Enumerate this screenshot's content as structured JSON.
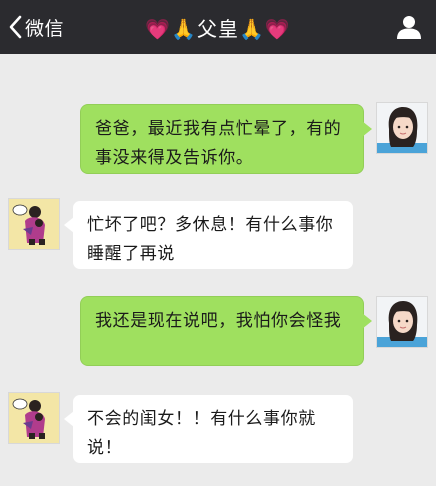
{
  "header": {
    "back_label": "微信",
    "title": "💗🙏父皇🙏💗"
  },
  "messages": [
    {
      "from": "me",
      "text": "爸爸，最近我有点忙晕了，有的事没来得及告诉你。"
    },
    {
      "from": "father",
      "text": "忙坏了吧？多休息！有什么事你睡醒了再说"
    },
    {
      "from": "me",
      "text": "我还是现在说吧，我怕你会怪我"
    },
    {
      "from": "father",
      "text": "不会的闺女！！有什么事你就说！"
    }
  ],
  "colors": {
    "nav_background": "#2b2b2f",
    "chat_background": "#ebebeb",
    "my_bubble": "#9fe05f",
    "other_bubble": "#ffffff"
  }
}
